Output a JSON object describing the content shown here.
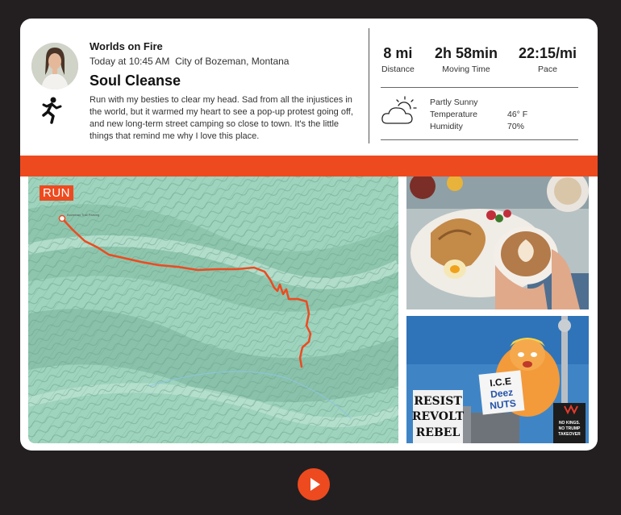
{
  "activity": {
    "club_name": "Worlds on Fire",
    "timestamp": "Today at 10:45 AM",
    "location": "City of Bozeman, Montana",
    "title": "Soul Cleanse",
    "description": "Run with my besties to clear my head. Sad from all the injustices in the world, but it warmed my heart to see a pop-up protest going off, and new long-term street camping so close to town. It's the little things that remind me why I love this place.",
    "type_icon": "running-person-icon"
  },
  "stats": [
    {
      "value": "8 mi",
      "label": "Distance"
    },
    {
      "value": "2h 58min",
      "label": "Moving Time"
    },
    {
      "value": "22:15/mi",
      "label": "Pace"
    }
  ],
  "weather": {
    "icon": "partly-sunny-icon",
    "condition": "Partly Sunny",
    "temperature_label": "Temperature",
    "temperature_value": "46° F",
    "humidity_label": "Humidity",
    "humidity_value": "70%"
  },
  "map": {
    "tag": "RUN",
    "start_label": "Bozeman Trail Parking"
  },
  "photos": [
    {
      "name": "breakfast-latte-photo"
    },
    {
      "name": "protest-photo",
      "signs": [
        "RESIST",
        "REVOLT",
        "REBEL",
        "I.C.E",
        "Deez",
        "NUTS",
        "NO KINGS.",
        "NO TRUMP",
        "TAKEOVER"
      ]
    }
  ],
  "colors": {
    "accent": "#ee4a1f",
    "background": "#231f20",
    "card": "#ffffff",
    "map": "#9ed3bd"
  },
  "controls": {
    "play_icon": "play-icon"
  }
}
